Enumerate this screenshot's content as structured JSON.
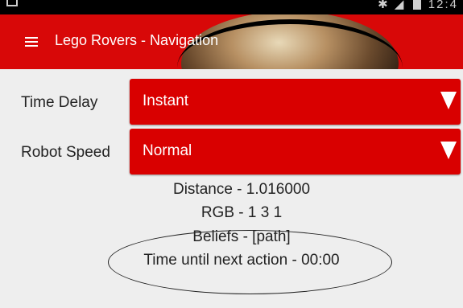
{
  "status_bar": {
    "time": "12:4",
    "icons": [
      "bluetooth-icon",
      "signal-icon",
      "battery-icon"
    ]
  },
  "app_bar": {
    "title": "Lego Rovers - Navigation",
    "menu_icon": "hamburger-menu-icon",
    "background_color": "#d80808"
  },
  "controls": {
    "time_delay": {
      "label": "Time Delay",
      "value": "Instant"
    },
    "robot_speed": {
      "label": "Robot Speed",
      "value": "Normal"
    }
  },
  "info": {
    "distance": "Distance - 1.016000",
    "rgb": "RGB - 1 3 1",
    "beliefs": "Beliefs - [path]",
    "next_action": "Time until next action - 00:00"
  },
  "colors": {
    "accent": "#d90000",
    "content_background": "#eeeeee"
  }
}
